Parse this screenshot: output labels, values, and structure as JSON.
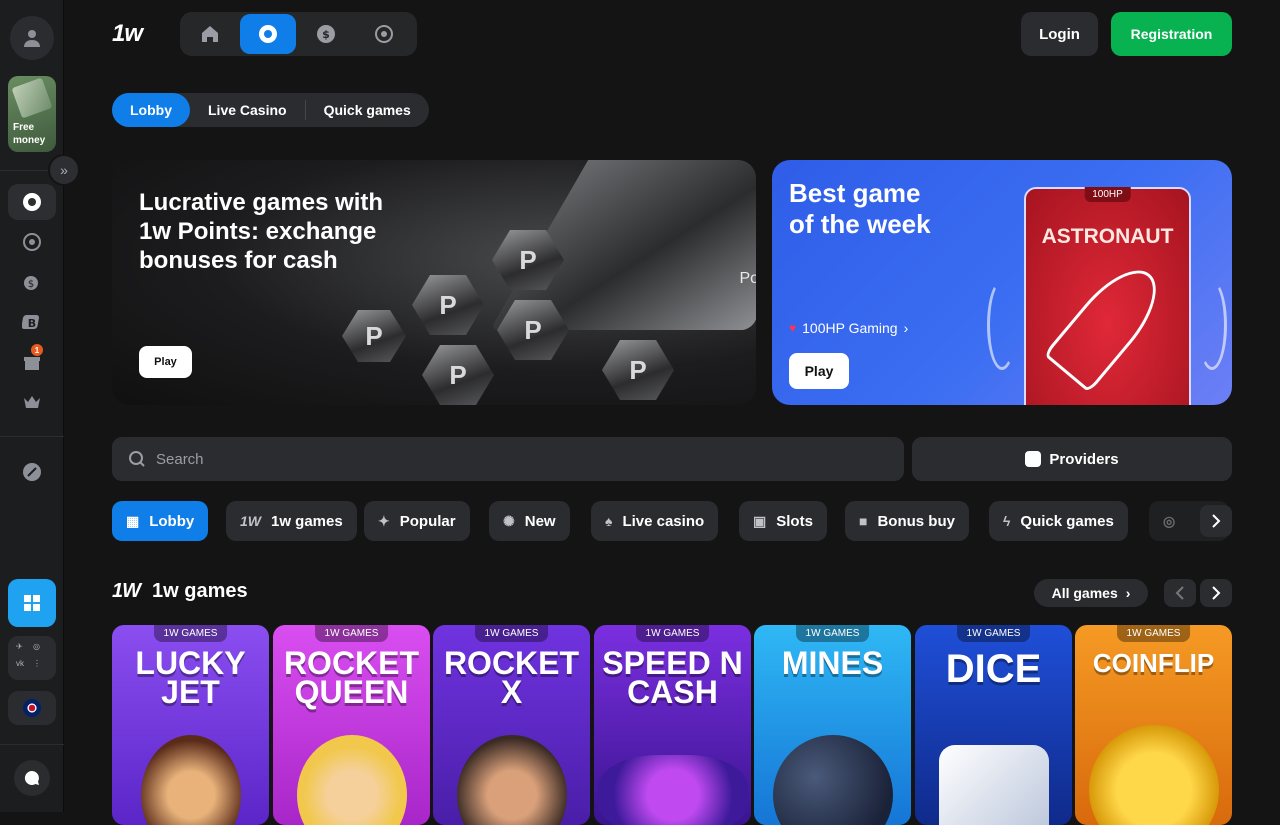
{
  "brand": {
    "logo": "1w"
  },
  "sidebar": {
    "free_money": "Free money",
    "badge_count": "1",
    "social": [
      "✈",
      "◎",
      "vk",
      "⋮"
    ]
  },
  "top_nav": {
    "items": [
      "home-icon",
      "casino-chip-icon",
      "dollar-icon",
      "soccer-ball-icon"
    ],
    "active": 1
  },
  "auth": {
    "login": "Login",
    "registration": "Registration"
  },
  "subnav": {
    "items": [
      "Lobby",
      "Live Casino",
      "Quick games"
    ]
  },
  "banner_points": {
    "title": "Lucrative games with 1w Points: exchange bonuses for cash",
    "play": "Play",
    "coin_letter": "P",
    "bar_text": "Points"
  },
  "banner_week": {
    "title_line1": "Best game",
    "title_line2": "of the week",
    "provider": "100HP Gaming",
    "play": "Play",
    "card_tag": "100HP",
    "card_name": "ASTRONAUT"
  },
  "search": {
    "placeholder": "Search"
  },
  "providers": {
    "label": "Providers"
  },
  "categories": [
    {
      "label": "Lobby",
      "icon": "grid-icon"
    },
    {
      "label": "1w games",
      "icon": "1w-logo-icon"
    },
    {
      "label": "Popular",
      "icon": "sparkle-icon"
    },
    {
      "label": "New",
      "icon": "new-badge-icon"
    },
    {
      "label": "Live casino",
      "icon": "spade-icon"
    },
    {
      "label": "Slots",
      "icon": "slot-machine-icon"
    },
    {
      "label": "Bonus buy",
      "icon": "gift-icon"
    },
    {
      "label": "Quick games",
      "icon": "lightning-icon"
    }
  ],
  "section": {
    "title": "1w games",
    "logo": "1W",
    "all_games": "All games"
  },
  "games": [
    {
      "tag": "1W GAMES",
      "name": "LUCKY JET",
      "color": "#7b3fe4"
    },
    {
      "tag": "1W GAMES",
      "name": "ROCKET QUEEN",
      "color": "#c13be0"
    },
    {
      "tag": "1W GAMES",
      "name": "ROCKET X",
      "color": "#5b2fcf"
    },
    {
      "tag": "1W GAMES",
      "name": "SPEED N CASH",
      "color": "#6c2ed8"
    },
    {
      "tag": "1W GAMES",
      "name": "MINES",
      "color": "#1ea4ea"
    },
    {
      "tag": "1W GAMES",
      "name": "DICE",
      "color": "#1c56d6"
    },
    {
      "tag": "1W GAMES",
      "name": "COINFLIP",
      "color": "#f08a1a"
    }
  ]
}
